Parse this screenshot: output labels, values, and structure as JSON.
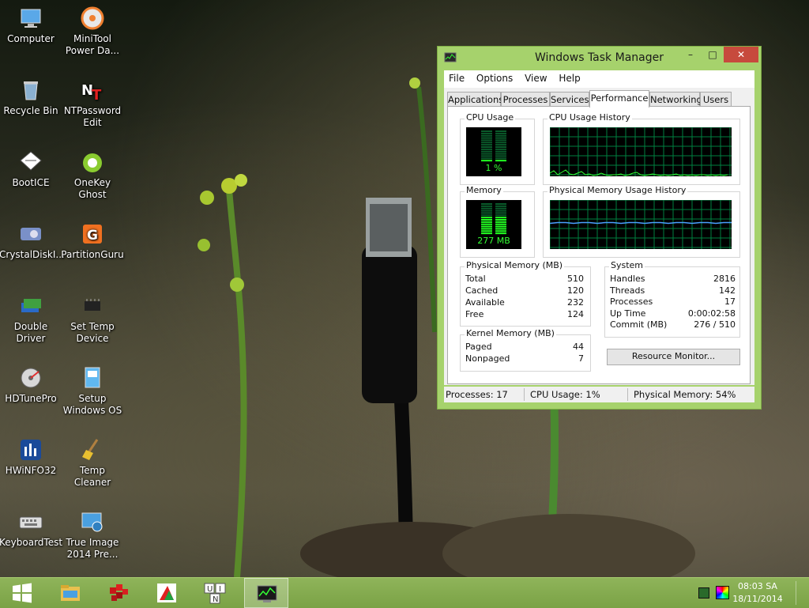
{
  "desktop": {
    "icons": [
      {
        "label": "Computer",
        "icon": "computer-icon"
      },
      {
        "label": "MiniTool Power Da...",
        "icon": "minitool-icon"
      },
      {
        "label": "Recycle Bin",
        "icon": "recycle-bin-icon"
      },
      {
        "label": "NTPassword Edit",
        "icon": "ntpassword-icon"
      },
      {
        "label": "BootICE",
        "icon": "bootice-icon"
      },
      {
        "label": "OneKey Ghost",
        "icon": "onekey-ghost-icon"
      },
      {
        "label": "CrystalDiskI...",
        "icon": "crystaldisk-icon"
      },
      {
        "label": "PartitionGuru",
        "icon": "partitionguru-icon"
      },
      {
        "label": "Double Driver",
        "icon": "double-driver-icon"
      },
      {
        "label": "Set Temp Device",
        "icon": "chip-icon"
      },
      {
        "label": "HDTunePro",
        "icon": "hdtune-icon"
      },
      {
        "label": "Setup Windows OS",
        "icon": "setup-icon"
      },
      {
        "label": "HWiNFO32",
        "icon": "hwinfo-icon"
      },
      {
        "label": "Temp Cleaner",
        "icon": "broom-icon"
      },
      {
        "label": "KeyboardTest",
        "icon": "keyboard-icon"
      },
      {
        "label": "True Image 2014 Pre...",
        "icon": "trueimage-icon"
      }
    ]
  },
  "window": {
    "title": "Windows Task Manager",
    "controls": {
      "minimize": "–",
      "maximize": "□",
      "close": "✕"
    },
    "menu": [
      "File",
      "Options",
      "View",
      "Help"
    ],
    "tabs": [
      "Applications",
      "Processes",
      "Services",
      "Performance",
      "Networking",
      "Users"
    ],
    "active_tab": "Performance",
    "cpu_usage": {
      "label": "CPU Usage",
      "value": "1 %",
      "percent": 1
    },
    "cpu_history": {
      "label": "CPU Usage History"
    },
    "memory": {
      "label": "Memory",
      "value": "277 MB",
      "percent": 54
    },
    "memory_history": {
      "label": "Physical Memory Usage History"
    },
    "physical_memory": {
      "label": "Physical Memory (MB)",
      "rows": [
        {
          "key": "Total",
          "value": "510"
        },
        {
          "key": "Cached",
          "value": "120"
        },
        {
          "key": "Available",
          "value": "232"
        },
        {
          "key": "Free",
          "value": "124"
        }
      ]
    },
    "kernel_memory": {
      "label": "Kernel Memory (MB)",
      "rows": [
        {
          "key": "Paged",
          "value": "44"
        },
        {
          "key": "Nonpaged",
          "value": "7"
        }
      ]
    },
    "system": {
      "label": "System",
      "rows": [
        {
          "key": "Handles",
          "value": "2816"
        },
        {
          "key": "Threads",
          "value": "142"
        },
        {
          "key": "Processes",
          "value": "17"
        },
        {
          "key": "Up Time",
          "value": "0:00:02:58"
        },
        {
          "key": "Commit (MB)",
          "value": "276 / 510"
        }
      ]
    },
    "resource_monitor_label": "Resource Monitor...",
    "status": {
      "processes": "Processes: 17",
      "cpu": "CPU Usage: 1%",
      "memory": "Physical Memory: 54%"
    }
  },
  "taskbar": {
    "items": [
      "start-icon",
      "file-explorer-icon",
      "puzzle-app-icon",
      "paint-app-icon",
      "unikey-icon",
      "task-manager-icon"
    ],
    "time": "08:03 SA",
    "date": "18/11/2014"
  },
  "colors": {
    "window_frame": "#a6d26c",
    "graph_grid": "#008040",
    "graph_line": "#00ff00"
  }
}
